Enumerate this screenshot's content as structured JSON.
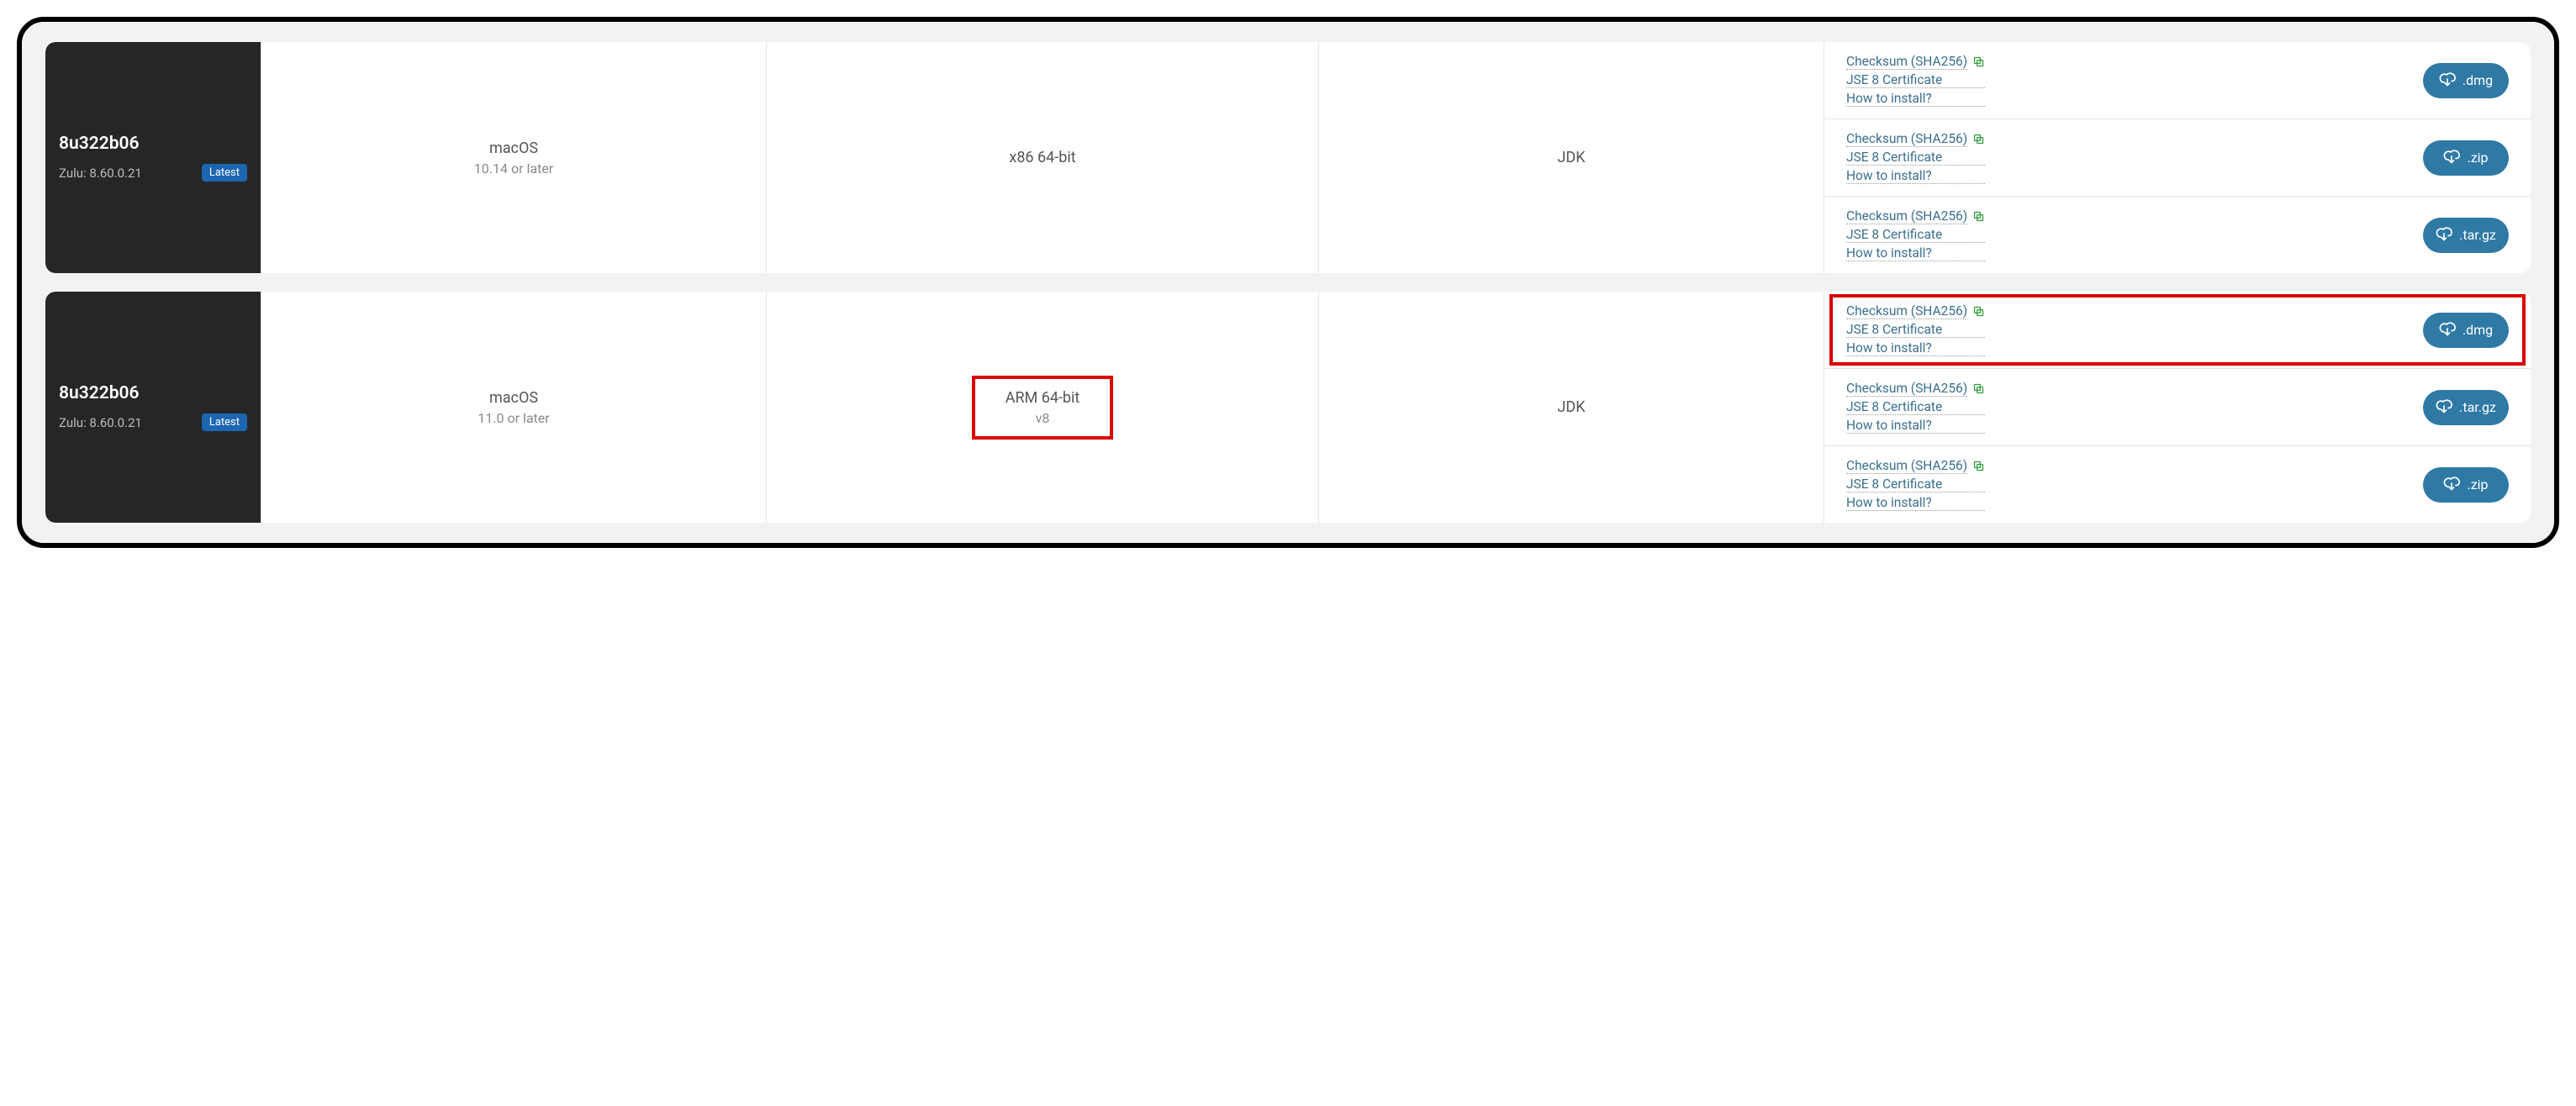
{
  "labels": {
    "latest": "Latest",
    "checksum": "Checksum (SHA256)",
    "certificate": "JSE 8 Certificate",
    "howto": "How to install?"
  },
  "blocks": [
    {
      "version": "8u322b06",
      "zulu": "Zulu: 8.60.0.21",
      "os": "macOS",
      "os_sub": "10.14 or later",
      "arch": "x86 64-bit",
      "arch_sub": "",
      "pkg": "JDK",
      "highlight_arch": false,
      "rows": [
        {
          "ext": ".dmg",
          "highlight": false
        },
        {
          "ext": ".zip",
          "highlight": false
        },
        {
          "ext": ".tar.gz",
          "highlight": false
        }
      ]
    },
    {
      "version": "8u322b06",
      "zulu": "Zulu: 8.60.0.21",
      "os": "macOS",
      "os_sub": "11.0 or later",
      "arch": "ARM 64-bit",
      "arch_sub": "v8",
      "pkg": "JDK",
      "highlight_arch": true,
      "rows": [
        {
          "ext": ".dmg",
          "highlight": true
        },
        {
          "ext": ".tar.gz",
          "highlight": false
        },
        {
          "ext": ".zip",
          "highlight": false
        }
      ]
    }
  ]
}
